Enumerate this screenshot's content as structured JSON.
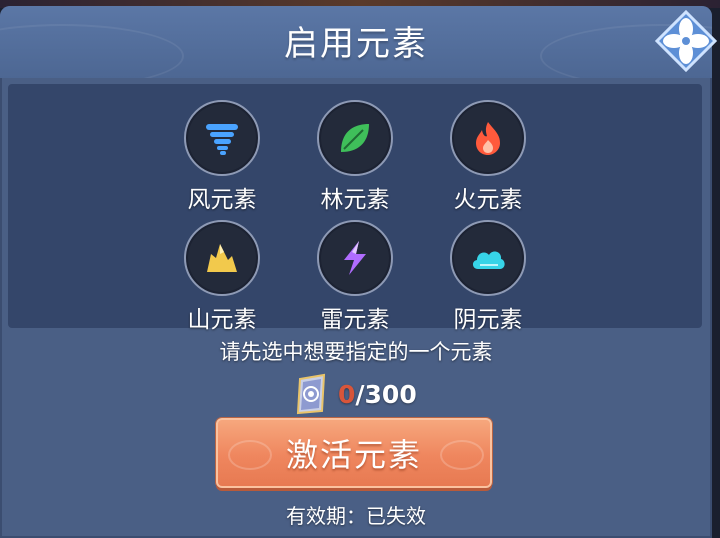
{
  "dialog": {
    "title": "启用元素"
  },
  "elements": [
    {
      "label": "风元素",
      "icon": "tornado-icon",
      "color": "#4aa3ff"
    },
    {
      "label": "林元素",
      "icon": "leaf-icon",
      "color": "#3fbf5a"
    },
    {
      "label": "火元素",
      "icon": "flame-icon",
      "color": "#ff5a3c"
    },
    {
      "label": "山元素",
      "icon": "mountain-icon",
      "color": "#f2c94c"
    },
    {
      "label": "雷元素",
      "icon": "lightning-icon",
      "color": "#b06cff"
    },
    {
      "label": "阴元素",
      "icon": "cloud-icon",
      "color": "#37d4e8"
    }
  ],
  "instruction": "请先选中想要指定的一个元素",
  "cost": {
    "current": "0",
    "separator_max": "/300",
    "icon": "crystal-token-icon"
  },
  "activate_button": {
    "label": "激活元素"
  },
  "validity": "有效期：已失效",
  "colors": {
    "panel": "#4a5f85",
    "button": "#ef865e",
    "cost_current": "#d8553a"
  }
}
